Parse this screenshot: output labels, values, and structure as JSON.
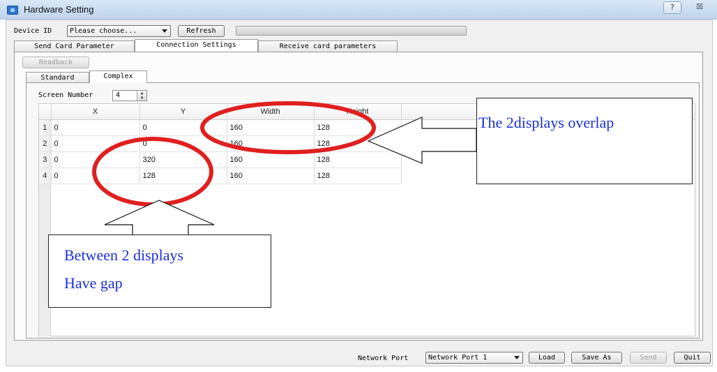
{
  "window": {
    "title": "Hardware Setting",
    "help_glyph": "?",
    "close_glyph": "☒"
  },
  "toolbar": {
    "device_id_label": "Device ID",
    "device_id_value": "Please choose...",
    "refresh_label": "Refresh"
  },
  "tabs": [
    {
      "label": "Send Card Parameter",
      "active": false
    },
    {
      "label": "Connection Settings",
      "active": true
    },
    {
      "label": "Receive card parameters",
      "active": false
    }
  ],
  "readback_label": "Readback",
  "subtabs": [
    {
      "label": "Standard",
      "active": false
    },
    {
      "label": "Complex",
      "active": true
    }
  ],
  "screen_number": {
    "label": "Screen Number",
    "value": "4"
  },
  "table": {
    "columns": [
      "X",
      "Y",
      "Width",
      "Height"
    ],
    "rows": [
      {
        "index": "1",
        "x": "0",
        "y": "0",
        "width": "160",
        "height": "128"
      },
      {
        "index": "2",
        "x": "0",
        "y": "0",
        "width": "160",
        "height": "128"
      },
      {
        "index": "3",
        "x": "0",
        "y": "320",
        "width": "160",
        "height": "128"
      },
      {
        "index": "4",
        "x": "0",
        "y": "128",
        "width": "160",
        "height": "128"
      }
    ]
  },
  "footer": {
    "network_port_label": "Network Port",
    "network_port_value": "Network Port 1",
    "load_label": "Load",
    "save_as_label": "Save As",
    "send_label": "Send",
    "quit_label": "Quit"
  },
  "annotations": {
    "overlap_text": "The 2displays overlap",
    "gap_line1": "Between 2 displays",
    "gap_line2": "Have gap",
    "highlight_color": "#e01f1f",
    "text_color": "#1a2fe0"
  }
}
